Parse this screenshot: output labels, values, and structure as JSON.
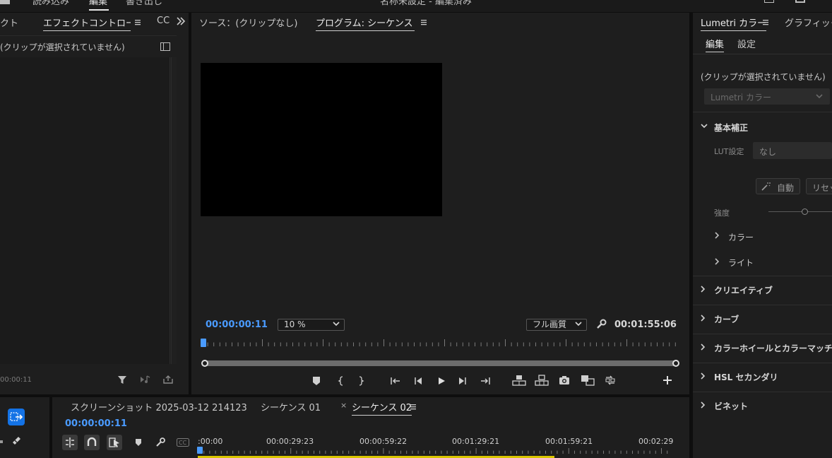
{
  "top_bar": {
    "left_items": [
      "読み込み",
      "編集",
      "書き出し"
    ],
    "title": "名称未設定 - 編集済み"
  },
  "left_panel": {
    "tab_project_fragment": "クト",
    "tab_effect_controls": "エフェクトコントロー/",
    "tab_cc": "CC",
    "no_clip": "(クリップが選択されていません)",
    "timecode": "00:00:11"
  },
  "program_monitor": {
    "tab_source": "ソース：(クリップなし)",
    "tab_program": "プログラム: シーケンス 0:",
    "timecode_current": "00:00:00:11",
    "zoom": "10 %",
    "quality": "フル画質",
    "timecode_duration": "00:01:55:06"
  },
  "lumetri": {
    "tab_lumetri": "Lumetri カラー",
    "tab_graphics": "グラフィック",
    "subtab_edit": "編集",
    "subtab_settings": "設定",
    "no_clip": "(クリップが選択されていません)",
    "dropdown": "Lumetri カラー",
    "basic_correction": "基本補正",
    "lut_label": "LUT設定",
    "lut_value": "なし",
    "auto_btn": "自動",
    "reset_btn": "リセッ",
    "intensity_label": "強度",
    "color": "カラー",
    "light": "ライト",
    "sections": [
      "クリエイティブ",
      "カーブ",
      "カラーホイールとカラーマッチ",
      "HSL セカンダリ",
      "ビネット"
    ]
  },
  "timeline": {
    "tabs": [
      "スクリーンショット 2025-03-12 214123",
      "シーケンス 01",
      "シーケンス 02"
    ],
    "close_glyph": "×",
    "timecode": "00:00:00:11",
    "ruler": [
      ":00:00",
      "00:00:29:23",
      "00:00:59:22",
      "00:01:29:21",
      "00:01:59:21",
      "00:02:29"
    ]
  },
  "colors": {
    "accent": "#4a9bff",
    "panel_bg": "#1e1e1e",
    "app_bg": "#0e0e0e",
    "work_area": "#d9c600"
  }
}
